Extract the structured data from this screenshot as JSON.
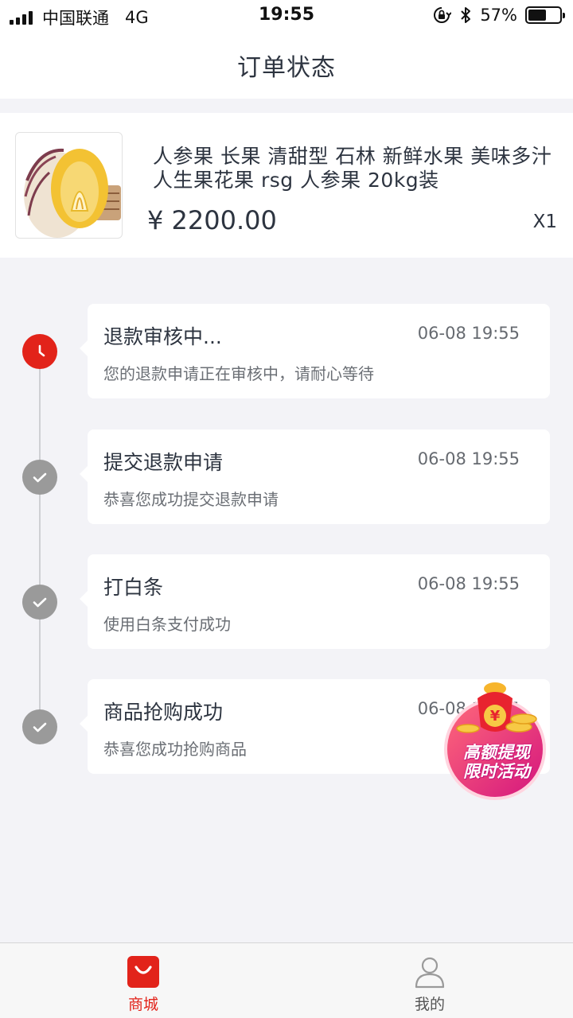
{
  "status_bar": {
    "carrier": "中国联通",
    "network": "4G",
    "time": "19:55",
    "battery_percent": "57%",
    "battery_level": 0.57,
    "icons": [
      "signal-icon",
      "orientation-lock-icon",
      "bluetooth-icon",
      "battery-icon"
    ]
  },
  "header": {
    "title": "订单状态"
  },
  "product": {
    "name": "人参果 长果 清甜型 石林 新鲜水果 美味多汁 人生果花果 rsg 人参果 20kg装",
    "price": "¥ 2200.00",
    "quantity": "X1"
  },
  "timeline": {
    "steps": [
      {
        "title": "退款审核中...",
        "time": "06-08 19:55",
        "desc": "您的退款申请正在审核中，请耐心等待",
        "status": "current",
        "icon": "clock-icon"
      },
      {
        "title": "提交退款申请",
        "time": "06-08 19:55",
        "desc": "恭喜您成功提交退款申请",
        "status": "done",
        "icon": "check-icon"
      },
      {
        "title": "打白条",
        "time": "06-08 19:55",
        "desc": "使用白条支付成功",
        "status": "done",
        "icon": "check-icon"
      },
      {
        "title": "商品抢购成功",
        "time": "06-08 19:55",
        "desc": "恭喜您成功抢购商品",
        "status": "done",
        "icon": "check-icon"
      }
    ]
  },
  "promo": {
    "line1": "高额提现",
    "line2": "限时活动",
    "symbol": "¥"
  },
  "tab_bar": {
    "items": [
      {
        "label": "商城",
        "icon": "shopping-bag-icon",
        "active": true
      },
      {
        "label": "我的",
        "icon": "user-icon",
        "active": false
      }
    ]
  },
  "colors": {
    "accent_red": "#e2231a",
    "page_background": "#f3f3f7",
    "text_primary": "#2d3440",
    "done_grey": "#9a9a9a"
  }
}
